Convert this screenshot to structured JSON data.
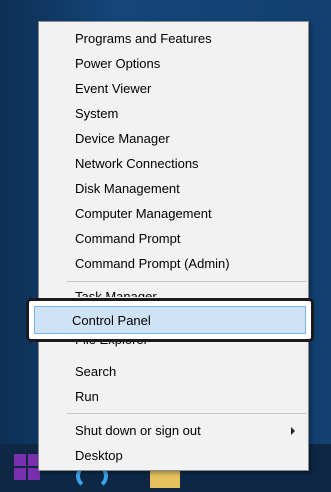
{
  "menu": {
    "items": [
      {
        "label": "Programs and Features"
      },
      {
        "label": "Power Options"
      },
      {
        "label": "Event Viewer"
      },
      {
        "label": "System"
      },
      {
        "label": "Device Manager"
      },
      {
        "label": "Network Connections"
      },
      {
        "label": "Disk Management"
      },
      {
        "label": "Computer Management"
      },
      {
        "label": "Command Prompt"
      },
      {
        "label": "Command Prompt (Admin)"
      },
      {
        "label": "Task Manager"
      },
      {
        "label": "Control Panel"
      },
      {
        "label": "File Explorer"
      },
      {
        "label": "Search"
      },
      {
        "label": "Run"
      },
      {
        "label": "Shut down or sign out"
      },
      {
        "label": "Desktop"
      }
    ]
  },
  "icons": {
    "start": "windows-start-icon",
    "ie": "internet-explorer-icon",
    "explorer": "file-explorer-icon",
    "submenu": "chevron-right-icon"
  },
  "colors": {
    "menu_bg": "#f2f2f2",
    "highlight_bg": "#cfe3f6",
    "highlight_border": "#7eb4e8",
    "desktop": "#12406f",
    "start_tile": "#7a2fae"
  }
}
